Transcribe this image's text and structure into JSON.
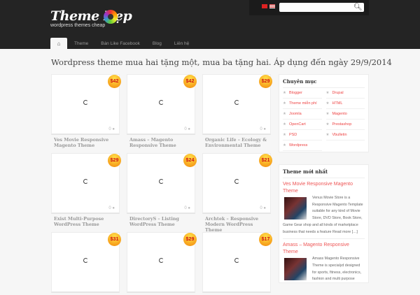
{
  "header": {
    "logo_title": "Theme Đẹp",
    "logo_subtitle": "wordpress themes cheap",
    "search_placeholder": "",
    "search_icon": "search-icon"
  },
  "nav": {
    "home_icon": "⌂",
    "items": [
      "Theme",
      "Bán Like Facebook",
      "Blog",
      "Liên hệ"
    ]
  },
  "page_title": "Wordpress theme mua hai tặng một, mua ba tặng hai. Áp dụng đến ngày 29/9/2014",
  "products": [
    {
      "title": "Ves Movie Responsive Magento Theme",
      "price": "$42",
      "comments": "0"
    },
    {
      "title": "Amass – Magento Responsive Theme",
      "price": "$42",
      "comments": "0"
    },
    {
      "title": "Organic Life – Ecology & Environmental Theme",
      "price": "$29",
      "comments": "0"
    },
    {
      "title": "Exist Multi-Purpose WordPress Theme",
      "price": "$29",
      "comments": "0"
    },
    {
      "title": "DirectoryS – Listing WordPress Theme",
      "price": "$24",
      "comments": "0"
    },
    {
      "title": "Archtek – Responsive Modern WordPress Theme",
      "price": "$21",
      "comments": "0"
    },
    {
      "title": "",
      "price": "$31",
      "comments": ""
    },
    {
      "title": "",
      "price": "$29",
      "comments": ""
    },
    {
      "title": "",
      "price": "$17",
      "comments": ""
    }
  ],
  "sidebar": {
    "categories_title": "Chuyên mục",
    "categories": [
      "Blogger",
      "Drupal",
      "Theme miễn phí",
      "HTML",
      "Joomla",
      "Magento",
      "OpenCart",
      "Prestashop",
      "PSD",
      "Vbulletin",
      "Wordpress"
    ],
    "latest_title": "Theme mới nhất",
    "posts": [
      {
        "title": "Ves Movie Responsive Magento Theme",
        "excerpt": "Venus Movie Store is a Responsive Magento Template suitable for any kind of Movie Store, DVD Store, Book Store, Game Gear shop and all kinds of marketplace business that needs a feature Read more […]"
      },
      {
        "title": "Amass – Magento Responsive Theme",
        "excerpt": "Amass Magento Responsive Theme is specialyd designed for sports, fitness, electronics, fashion and multi purpose"
      }
    ]
  }
}
